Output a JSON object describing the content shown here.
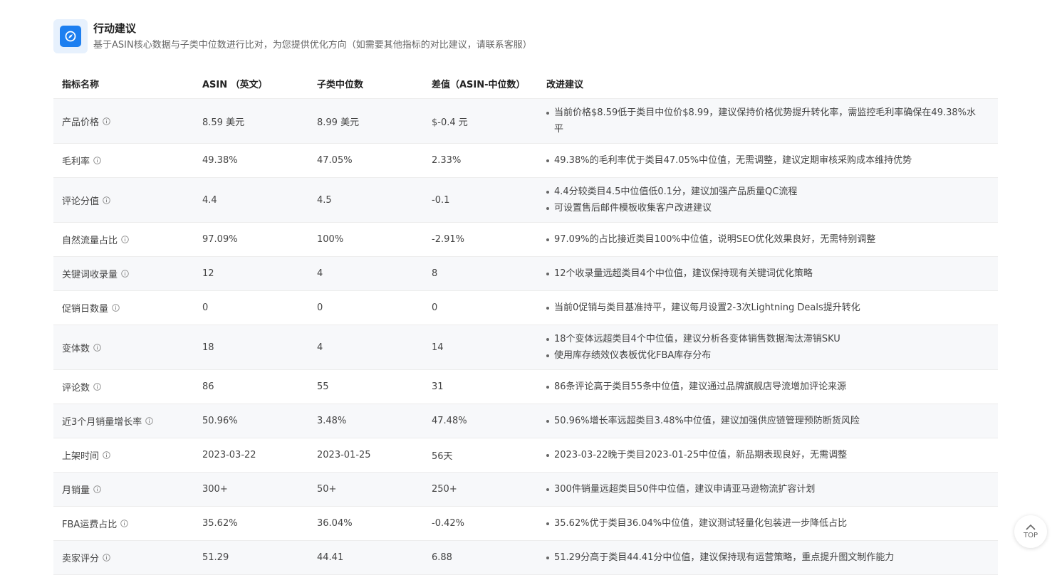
{
  "header": {
    "title": "行动建议",
    "subtitle": "基于ASIN核心数据与子类中位数进行比对，为您提供优化方向（如需要其他指标的对比建议，请联系客服）",
    "logo_icon": "compass-icon",
    "accent_color": "#1d7ff0"
  },
  "table": {
    "columns": [
      "指标名称",
      "ASIN （英文）",
      "子类中位数",
      "差值（ASIN-中位数）",
      "改进建议"
    ],
    "rows": [
      {
        "name": "产品价格",
        "asin": "8.59 美元",
        "median": "8.99 美元",
        "diff": "$-0.4 元",
        "suggestions": [
          "当前价格$8.59低于类目中位价$8.99，建议保持价格优势提升转化率，需监控毛利率确保在49.38%水平"
        ]
      },
      {
        "name": "毛利率",
        "asin": "49.38%",
        "median": "47.05%",
        "diff": "2.33%",
        "suggestions": [
          "49.38%的毛利率优于类目47.05%中位值，无需调整，建议定期审核采购成本维持优势"
        ]
      },
      {
        "name": "评论分值",
        "asin": "4.4",
        "median": "4.5",
        "diff": "-0.1",
        "suggestions": [
          "4.4分较类目4.5中位值低0.1分，建议加强产品质量QC流程",
          "可设置售后邮件模板收集客户改进建议"
        ]
      },
      {
        "name": "自然流量占比",
        "asin": "97.09%",
        "median": "100%",
        "diff": "-2.91%",
        "suggestions": [
          "97.09%的占比接近类目100%中位值，说明SEO优化效果良好，无需特别调整"
        ]
      },
      {
        "name": "关键词收录量",
        "asin": "12",
        "median": "4",
        "diff": "8",
        "suggestions": [
          "12个收录量远超类目4个中位值，建议保持现有关键词优化策略"
        ]
      },
      {
        "name": "促销日数量",
        "asin": "0",
        "median": "0",
        "diff": "0",
        "suggestions": [
          "当前0促销与类目基准持平，建议每月设置2-3次Lightning Deals提升转化"
        ]
      },
      {
        "name": "变体数",
        "asin": "18",
        "median": "4",
        "diff": "14",
        "suggestions": [
          "18个变体远超类目4个中位值，建议分析各变体销售数据淘汰滞销SKU",
          "使用库存绩效仪表板优化FBA库存分布"
        ]
      },
      {
        "name": "评论数",
        "asin": "86",
        "median": "55",
        "diff": "31",
        "suggestions": [
          "86条评论高于类目55条中位值，建议通过品牌旗舰店导流增加评论来源"
        ]
      },
      {
        "name": "近3个月销量增长率",
        "asin": "50.96%",
        "median": "3.48%",
        "diff": "47.48%",
        "suggestions": [
          "50.96%增长率远超类目3.48%中位值，建议加强供应链管理预防断货风险"
        ]
      },
      {
        "name": "上架时间",
        "asin": "2023-03-22",
        "median": "2023-01-25",
        "diff": "56天",
        "suggestions": [
          "2023-03-22晚于类目2023-01-25中位值，新品期表现良好，无需调整"
        ]
      },
      {
        "name": "月销量",
        "asin": "300+",
        "median": "50+",
        "diff": "250+",
        "suggestions": [
          "300件销量远超类目50件中位值，建议申请亚马逊物流扩容计划"
        ]
      },
      {
        "name": "FBA运费占比",
        "asin": "35.62%",
        "median": "36.04%",
        "diff": "-0.42%",
        "suggestions": [
          "35.62%优于类目36.04%中位值，建议测试轻量化包装进一步降低占比"
        ]
      },
      {
        "name": "卖家评分",
        "asin": "51.29",
        "median": "44.41",
        "diff": "6.88",
        "suggestions": [
          "51.29分高于类目44.41分中位值，建议保持现有运营策略，重点提升图文制作能力"
        ]
      }
    ]
  },
  "back_to_top": {
    "label": "TOP",
    "icon": "chevron-up-icon"
  }
}
